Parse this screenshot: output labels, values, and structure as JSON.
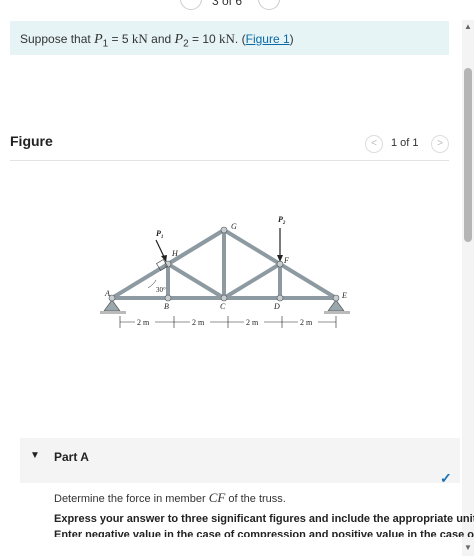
{
  "nav": {
    "page_indicator": "3 of 6",
    "prev": "‹",
    "next": "›"
  },
  "given": {
    "prefix": "Suppose that",
    "p1_sym": "P",
    "p1_sub": "1",
    "p1_val": "= 5",
    "p1_unit": "kN",
    "and": "and",
    "p2_sym": "P",
    "p2_sub": "2",
    "p2_val": "= 10",
    "p2_unit": "kN",
    "link_open": "(",
    "link": "Figure 1",
    "link_close": ")"
  },
  "figure": {
    "title": "Figure",
    "counter": "1 of 1",
    "prev": "<",
    "next": ">",
    "labels": {
      "A": "A",
      "B": "B",
      "C": "C",
      "D": "D",
      "E": "E",
      "F": "F",
      "G": "G",
      "H": "H",
      "P1": "P",
      "P1_sub": "1",
      "P2": "P",
      "P2_sub": "2",
      "angle": "30°",
      "dims": [
        "2 m",
        "2 m",
        "2 m",
        "2 m"
      ]
    }
  },
  "part": {
    "label": "Part A",
    "question_prefix": "Determine the force in member",
    "member": "CF",
    "question_suffix": "of the truss.",
    "instructions": "Express your answer to three significant figures and include the appropriate units.",
    "instructions2": "Enter negative value in the case of compression and positive value in the case of"
  },
  "colors": {
    "accent": "#0a6aa8",
    "given_bg": "#e6f4f6",
    "check": "#1a6fb0"
  }
}
